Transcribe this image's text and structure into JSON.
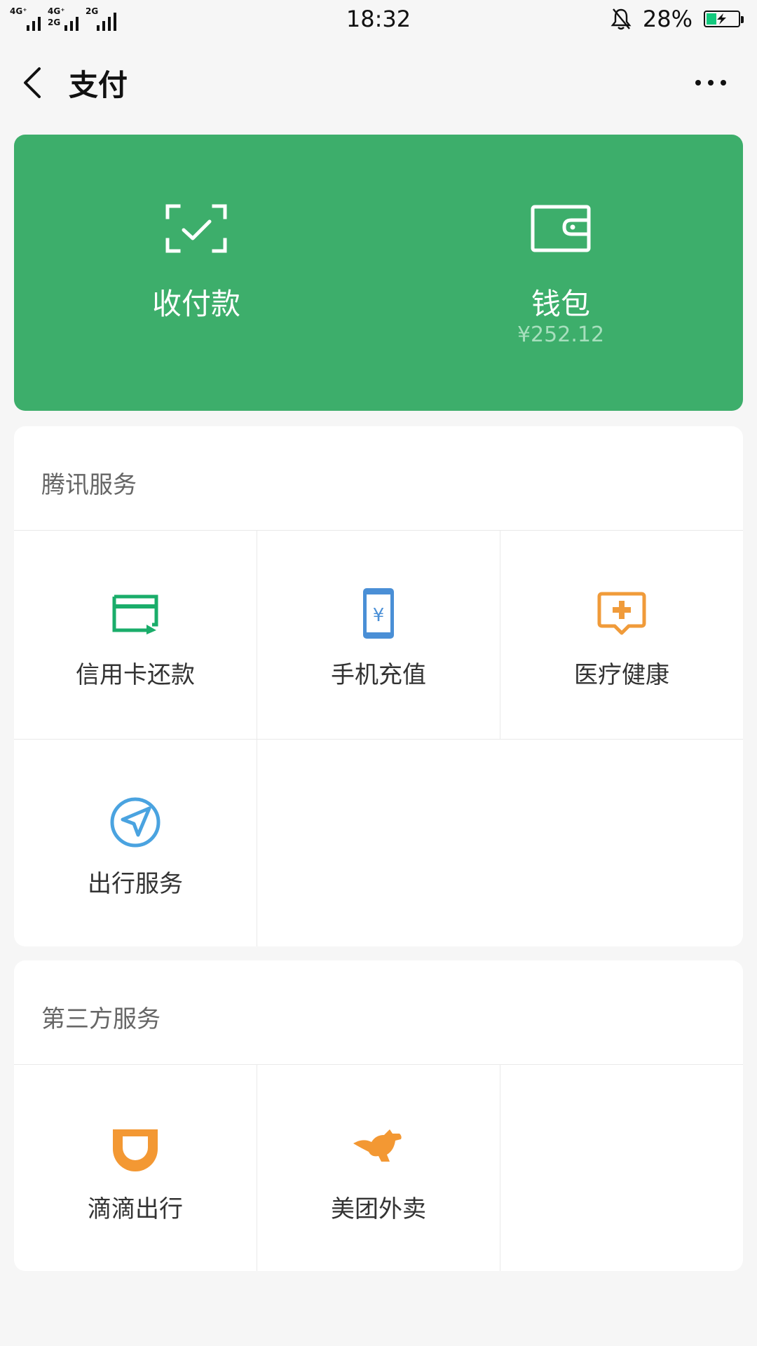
{
  "status_bar": {
    "network_1": "4G⁺",
    "network_1b": "4G⁺",
    "network_2": "2G",
    "network_3": "2G",
    "time": "18:32",
    "battery": "28%"
  },
  "header": {
    "title": "支付",
    "back_icon": "chevron-left-icon",
    "more_icon": "more-icon"
  },
  "top_card": {
    "accent": "#3dae6b",
    "receive_pay": {
      "label": "收付款",
      "icon": "scan-check-icon"
    },
    "wallet": {
      "label": "钱包",
      "balance": "¥252.12",
      "icon": "wallet-icon"
    }
  },
  "tencent_services": {
    "title": "腾讯服务",
    "items": [
      {
        "label": "信用卡还款",
        "icon": "credit-card-icon",
        "color": "#1aad6a"
      },
      {
        "label": "手机充值",
        "icon": "phone-recharge-icon",
        "color": "#4a8fd6"
      },
      {
        "label": "医疗健康",
        "icon": "medical-icon",
        "color": "#f09b3a"
      },
      {
        "label": "出行服务",
        "icon": "navigation-icon",
        "color": "#4aa3e0"
      }
    ]
  },
  "third_party_services": {
    "title": "第三方服务",
    "items": [
      {
        "label": "滴滴出行",
        "icon": "didi-icon",
        "color": "#f39833"
      },
      {
        "label": "美团外卖",
        "icon": "kangaroo-icon",
        "color": "#f39833"
      }
    ]
  }
}
